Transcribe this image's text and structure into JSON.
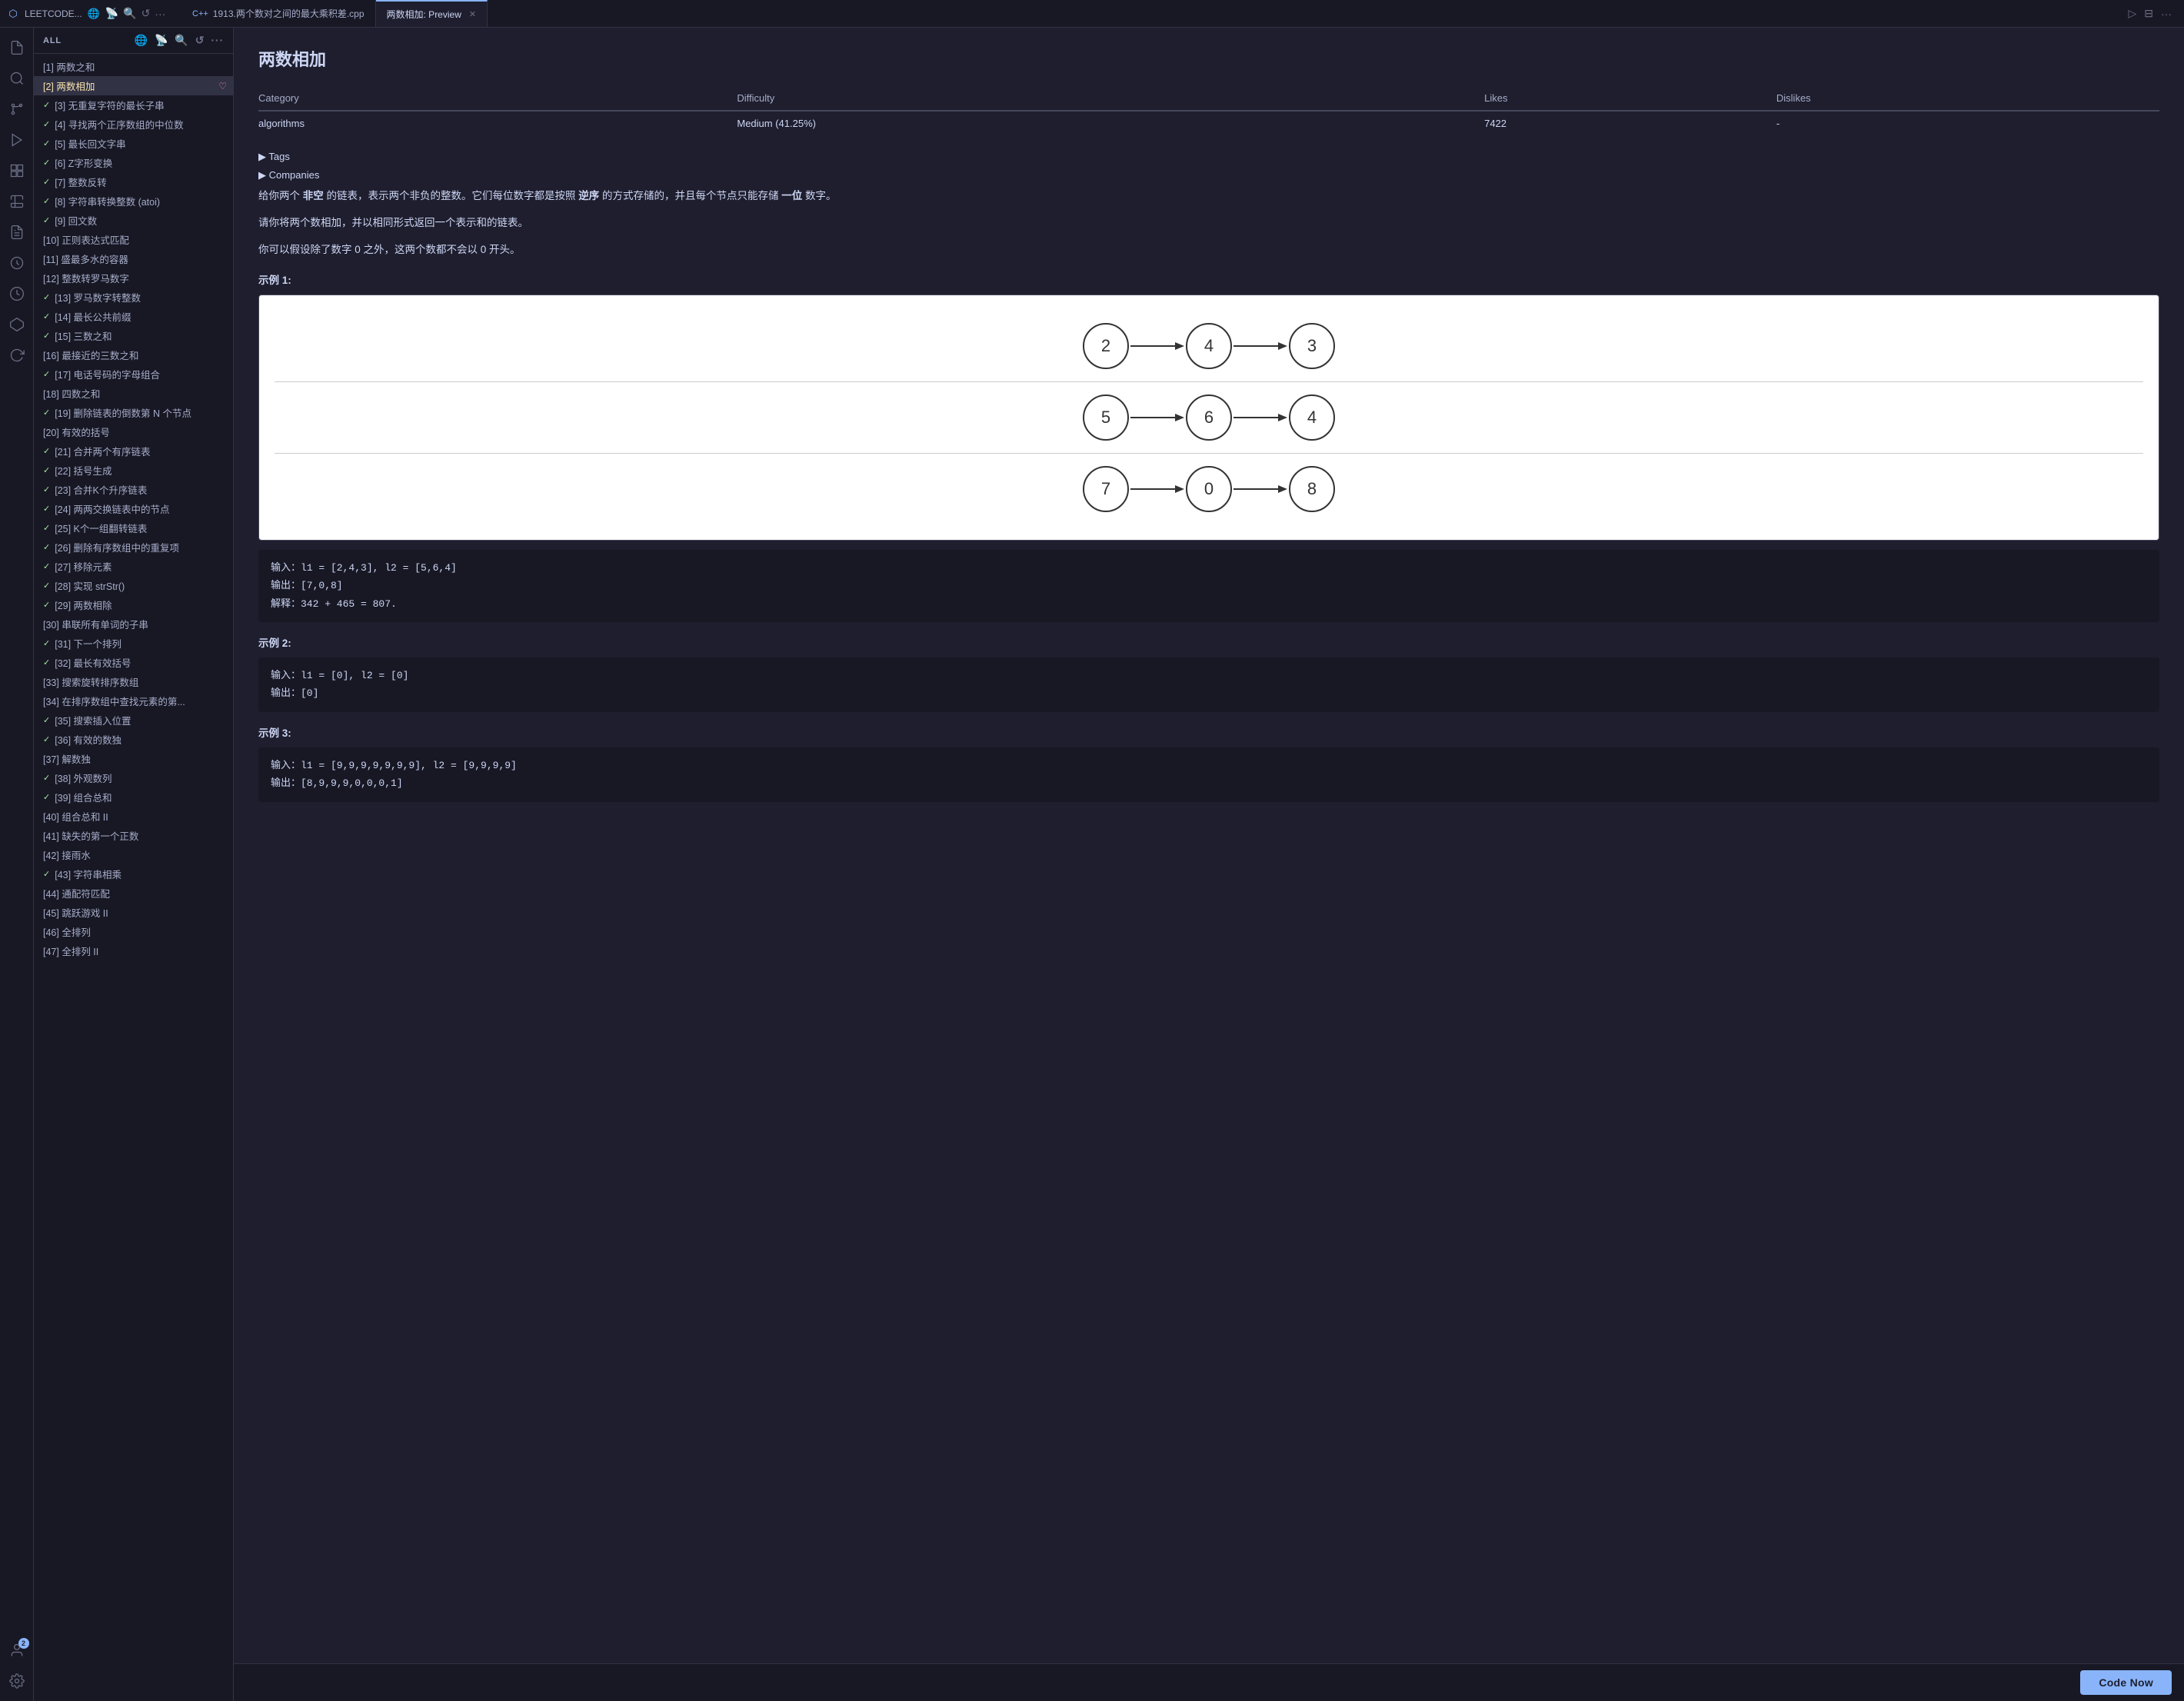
{
  "titlebar": {
    "app_name": "LEETCODE...",
    "tab1_label": "1913.两个数对之间的最大乘积差.cpp",
    "tab2_label": "两数相加: Preview",
    "tab1_icon": "C++",
    "actions": [
      "run",
      "split",
      "more"
    ]
  },
  "activitybar": {
    "items": [
      {
        "name": "files",
        "icon": "📄",
        "active": false
      },
      {
        "name": "search",
        "icon": "🔍",
        "active": false
      },
      {
        "name": "source-control",
        "icon": "⎇",
        "active": false
      },
      {
        "name": "debug",
        "icon": "▷",
        "active": false
      },
      {
        "name": "extensions",
        "icon": "⊞",
        "active": false
      },
      {
        "name": "leetcode",
        "icon": "🧪",
        "active": false
      },
      {
        "name": "problems",
        "icon": "📋",
        "active": false
      },
      {
        "name": "solutions",
        "icon": "💡",
        "active": false
      },
      {
        "name": "history",
        "icon": "🕐",
        "active": false
      },
      {
        "name": "blocks",
        "icon": "⬡",
        "active": false
      },
      {
        "name": "refresh",
        "icon": "↺",
        "active": false
      }
    ],
    "bottom_items": [
      {
        "name": "account",
        "icon": "👤",
        "badge": "2"
      },
      {
        "name": "settings",
        "icon": "⚙",
        "active": false
      }
    ]
  },
  "sidebar": {
    "header": "ALL",
    "items": [
      {
        "number": 1,
        "title": "两数之和",
        "solved": false,
        "active": false
      },
      {
        "number": 2,
        "title": "两数相加",
        "solved": false,
        "active": true,
        "heart": true
      },
      {
        "number": 3,
        "title": "无重复字符的最长子串",
        "solved": true,
        "active": false
      },
      {
        "number": 4,
        "title": "寻找两个正序数组的中位数",
        "solved": true,
        "active": false
      },
      {
        "number": 5,
        "title": "最长回文字串",
        "solved": true,
        "active": false
      },
      {
        "number": 6,
        "title": "Z字形变换",
        "solved": true,
        "active": false
      },
      {
        "number": 7,
        "title": "整数反转",
        "solved": true,
        "active": false
      },
      {
        "number": 8,
        "title": "字符串转换整数 (atoi)",
        "solved": true,
        "active": false
      },
      {
        "number": 9,
        "title": "回文数",
        "solved": true,
        "active": false
      },
      {
        "number": 10,
        "title": "正则表达式匹配",
        "solved": false,
        "active": false
      },
      {
        "number": 11,
        "title": "盛最多水的容器",
        "solved": false,
        "active": false
      },
      {
        "number": 12,
        "title": "整数转罗马数字",
        "solved": false,
        "active": false
      },
      {
        "number": 13,
        "title": "罗马数字转整数",
        "solved": true,
        "active": false
      },
      {
        "number": 14,
        "title": "最长公共前缀",
        "solved": true,
        "active": false
      },
      {
        "number": 15,
        "title": "三数之和",
        "solved": true,
        "active": false
      },
      {
        "number": 16,
        "title": "最接近的三数之和",
        "solved": false,
        "active": false
      },
      {
        "number": 17,
        "title": "电话号码的字母组合",
        "solved": true,
        "active": false
      },
      {
        "number": 18,
        "title": "四数之和",
        "solved": false,
        "active": false
      },
      {
        "number": 19,
        "title": "删除链表的倒数第 N 个节点",
        "solved": true,
        "active": false
      },
      {
        "number": 20,
        "title": "有效的括号",
        "solved": false,
        "active": false
      },
      {
        "number": 21,
        "title": "合并两个有序链表",
        "solved": true,
        "active": false
      },
      {
        "number": 22,
        "title": "括号生成",
        "solved": true,
        "active": false
      },
      {
        "number": 23,
        "title": "合并K个升序链表",
        "solved": true,
        "active": false
      },
      {
        "number": 24,
        "title": "两两交换链表中的节点",
        "solved": true,
        "active": false
      },
      {
        "number": 25,
        "title": "K个一组翻转链表",
        "solved": true,
        "active": false
      },
      {
        "number": 26,
        "title": "删除有序数组中的重复项",
        "solved": true,
        "active": false
      },
      {
        "number": 27,
        "title": "移除元素",
        "solved": true,
        "active": false
      },
      {
        "number": 28,
        "title": "实现 strStr()",
        "solved": true,
        "active": false
      },
      {
        "number": 29,
        "title": "两数相除",
        "solved": true,
        "active": false
      },
      {
        "number": 30,
        "title": "串联所有单词的子串",
        "solved": false,
        "active": false
      },
      {
        "number": 31,
        "title": "下一个排列",
        "solved": true,
        "active": false
      },
      {
        "number": 32,
        "title": "最长有效括号",
        "solved": true,
        "active": false
      },
      {
        "number": 33,
        "title": "搜索旋转排序数组",
        "solved": false,
        "active": false
      },
      {
        "number": 34,
        "title": "在排序数组中查找元素的第...",
        "solved": false,
        "active": false
      },
      {
        "number": 35,
        "title": "搜索插入位置",
        "solved": true,
        "active": false
      },
      {
        "number": 36,
        "title": "有效的数独",
        "solved": true,
        "active": false
      },
      {
        "number": 37,
        "title": "解数独",
        "solved": false,
        "active": false
      },
      {
        "number": 38,
        "title": "外观数列",
        "solved": true,
        "active": false
      },
      {
        "number": 39,
        "title": "组合总和",
        "solved": true,
        "active": false
      },
      {
        "number": 40,
        "title": "组合总和 II",
        "solved": false,
        "active": false
      },
      {
        "number": 41,
        "title": "缺失的第一个正数",
        "solved": false,
        "active": false
      },
      {
        "number": 42,
        "title": "接雨水",
        "solved": false,
        "active": false
      },
      {
        "number": 43,
        "title": "字符串相乘",
        "solved": true,
        "active": false
      },
      {
        "number": 44,
        "title": "通配符匹配",
        "solved": false,
        "active": false
      },
      {
        "number": 45,
        "title": "跳跃游戏 II",
        "solved": false,
        "active": false
      },
      {
        "number": 46,
        "title": "全排列",
        "solved": false,
        "active": false
      },
      {
        "number": 47,
        "title": "全排列 II",
        "solved": false,
        "active": false
      }
    ]
  },
  "problem": {
    "title": "两数相加",
    "table": {
      "headers": [
        "Category",
        "Difficulty",
        "Likes",
        "Dislikes"
      ],
      "row": [
        "algorithms",
        "Medium (41.25%)",
        "7422",
        "-"
      ]
    },
    "tags_label": "▶ Tags",
    "companies_label": "▶ Companies",
    "description_parts": [
      "给你两个 非空 的链表，表示两个非负的整数。它们每位数字都是按照 逆序 的方式存储的，并且每个节点只能存储 一位 数字。",
      "请你将两个数相加，并以相同形式返回一个表示和的链表。",
      "你可以假设除了数字 0 之外，这两个数都不会以 0 开头。"
    ],
    "examples": [
      {
        "title": "示例 1:",
        "diagram": {
          "row1": [
            2,
            4,
            3
          ],
          "row2": [
            5,
            6,
            4
          ],
          "row3": [
            7,
            0,
            8
          ]
        },
        "input": "输入：l1 = [2,4,3], l2 = [5,6,4]",
        "output": "输出：[7,0,8]",
        "explanation": "解释：342 + 465 = 807."
      },
      {
        "title": "示例 2:",
        "input": "输入：l1 = [0], l2 = [0]",
        "output": "输出：[0]"
      },
      {
        "title": "示例 3:",
        "input": "输入：l1 = [9,9,9,9,9,9,9], l2 = [9,9,9,9]",
        "output": "输出：[8,9,9,9,0,0,0,1]"
      }
    ],
    "code_now_btn": "Code Now"
  }
}
